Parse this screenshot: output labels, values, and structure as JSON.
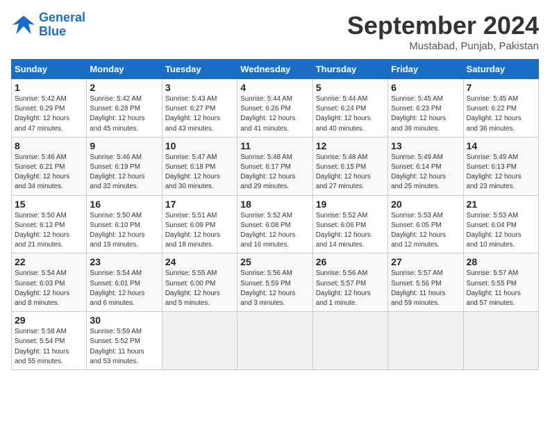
{
  "header": {
    "logo_line1": "General",
    "logo_line2": "Blue",
    "month": "September 2024",
    "location": "Mustabad, Punjab, Pakistan"
  },
  "weekdays": [
    "Sunday",
    "Monday",
    "Tuesday",
    "Wednesday",
    "Thursday",
    "Friday",
    "Saturday"
  ],
  "weeks": [
    [
      {
        "day": "1",
        "info": "Sunrise: 5:42 AM\nSunset: 6:29 PM\nDaylight: 12 hours\nand 47 minutes."
      },
      {
        "day": "2",
        "info": "Sunrise: 5:42 AM\nSunset: 6:28 PM\nDaylight: 12 hours\nand 45 minutes."
      },
      {
        "day": "3",
        "info": "Sunrise: 5:43 AM\nSunset: 6:27 PM\nDaylight: 12 hours\nand 43 minutes."
      },
      {
        "day": "4",
        "info": "Sunrise: 5:44 AM\nSunset: 6:26 PM\nDaylight: 12 hours\nand 41 minutes."
      },
      {
        "day": "5",
        "info": "Sunrise: 5:44 AM\nSunset: 6:24 PM\nDaylight: 12 hours\nand 40 minutes."
      },
      {
        "day": "6",
        "info": "Sunrise: 5:45 AM\nSunset: 6:23 PM\nDaylight: 12 hours\nand 38 minutes."
      },
      {
        "day": "7",
        "info": "Sunrise: 5:45 AM\nSunset: 6:22 PM\nDaylight: 12 hours\nand 36 minutes."
      }
    ],
    [
      {
        "day": "8",
        "info": "Sunrise: 5:46 AM\nSunset: 6:21 PM\nDaylight: 12 hours\nand 34 minutes."
      },
      {
        "day": "9",
        "info": "Sunrise: 5:46 AM\nSunset: 6:19 PM\nDaylight: 12 hours\nand 32 minutes."
      },
      {
        "day": "10",
        "info": "Sunrise: 5:47 AM\nSunset: 6:18 PM\nDaylight: 12 hours\nand 30 minutes."
      },
      {
        "day": "11",
        "info": "Sunrise: 5:48 AM\nSunset: 6:17 PM\nDaylight: 12 hours\nand 29 minutes."
      },
      {
        "day": "12",
        "info": "Sunrise: 5:48 AM\nSunset: 6:15 PM\nDaylight: 12 hours\nand 27 minutes."
      },
      {
        "day": "13",
        "info": "Sunrise: 5:49 AM\nSunset: 6:14 PM\nDaylight: 12 hours\nand 25 minutes."
      },
      {
        "day": "14",
        "info": "Sunrise: 5:49 AM\nSunset: 6:13 PM\nDaylight: 12 hours\nand 23 minutes."
      }
    ],
    [
      {
        "day": "15",
        "info": "Sunrise: 5:50 AM\nSunset: 6:12 PM\nDaylight: 12 hours\nand 21 minutes."
      },
      {
        "day": "16",
        "info": "Sunrise: 5:50 AM\nSunset: 6:10 PM\nDaylight: 12 hours\nand 19 minutes."
      },
      {
        "day": "17",
        "info": "Sunrise: 5:51 AM\nSunset: 6:09 PM\nDaylight: 12 hours\nand 18 minutes."
      },
      {
        "day": "18",
        "info": "Sunrise: 5:52 AM\nSunset: 6:08 PM\nDaylight: 12 hours\nand 16 minutes."
      },
      {
        "day": "19",
        "info": "Sunrise: 5:52 AM\nSunset: 6:06 PM\nDaylight: 12 hours\nand 14 minutes."
      },
      {
        "day": "20",
        "info": "Sunrise: 5:53 AM\nSunset: 6:05 PM\nDaylight: 12 hours\nand 12 minutes."
      },
      {
        "day": "21",
        "info": "Sunrise: 5:53 AM\nSunset: 6:04 PM\nDaylight: 12 hours\nand 10 minutes."
      }
    ],
    [
      {
        "day": "22",
        "info": "Sunrise: 5:54 AM\nSunset: 6:03 PM\nDaylight: 12 hours\nand 8 minutes."
      },
      {
        "day": "23",
        "info": "Sunrise: 5:54 AM\nSunset: 6:01 PM\nDaylight: 12 hours\nand 6 minutes."
      },
      {
        "day": "24",
        "info": "Sunrise: 5:55 AM\nSunset: 6:00 PM\nDaylight: 12 hours\nand 5 minutes."
      },
      {
        "day": "25",
        "info": "Sunrise: 5:56 AM\nSunset: 5:59 PM\nDaylight: 12 hours\nand 3 minutes."
      },
      {
        "day": "26",
        "info": "Sunrise: 5:56 AM\nSunset: 5:57 PM\nDaylight: 12 hours\nand 1 minute."
      },
      {
        "day": "27",
        "info": "Sunrise: 5:57 AM\nSunset: 5:56 PM\nDaylight: 11 hours\nand 59 minutes."
      },
      {
        "day": "28",
        "info": "Sunrise: 5:57 AM\nSunset: 5:55 PM\nDaylight: 11 hours\nand 57 minutes."
      }
    ],
    [
      {
        "day": "29",
        "info": "Sunrise: 5:58 AM\nSunset: 5:54 PM\nDaylight: 11 hours\nand 55 minutes."
      },
      {
        "day": "30",
        "info": "Sunrise: 5:59 AM\nSunset: 5:52 PM\nDaylight: 11 hours\nand 53 minutes."
      },
      {
        "day": "",
        "info": ""
      },
      {
        "day": "",
        "info": ""
      },
      {
        "day": "",
        "info": ""
      },
      {
        "day": "",
        "info": ""
      },
      {
        "day": "",
        "info": ""
      }
    ]
  ]
}
